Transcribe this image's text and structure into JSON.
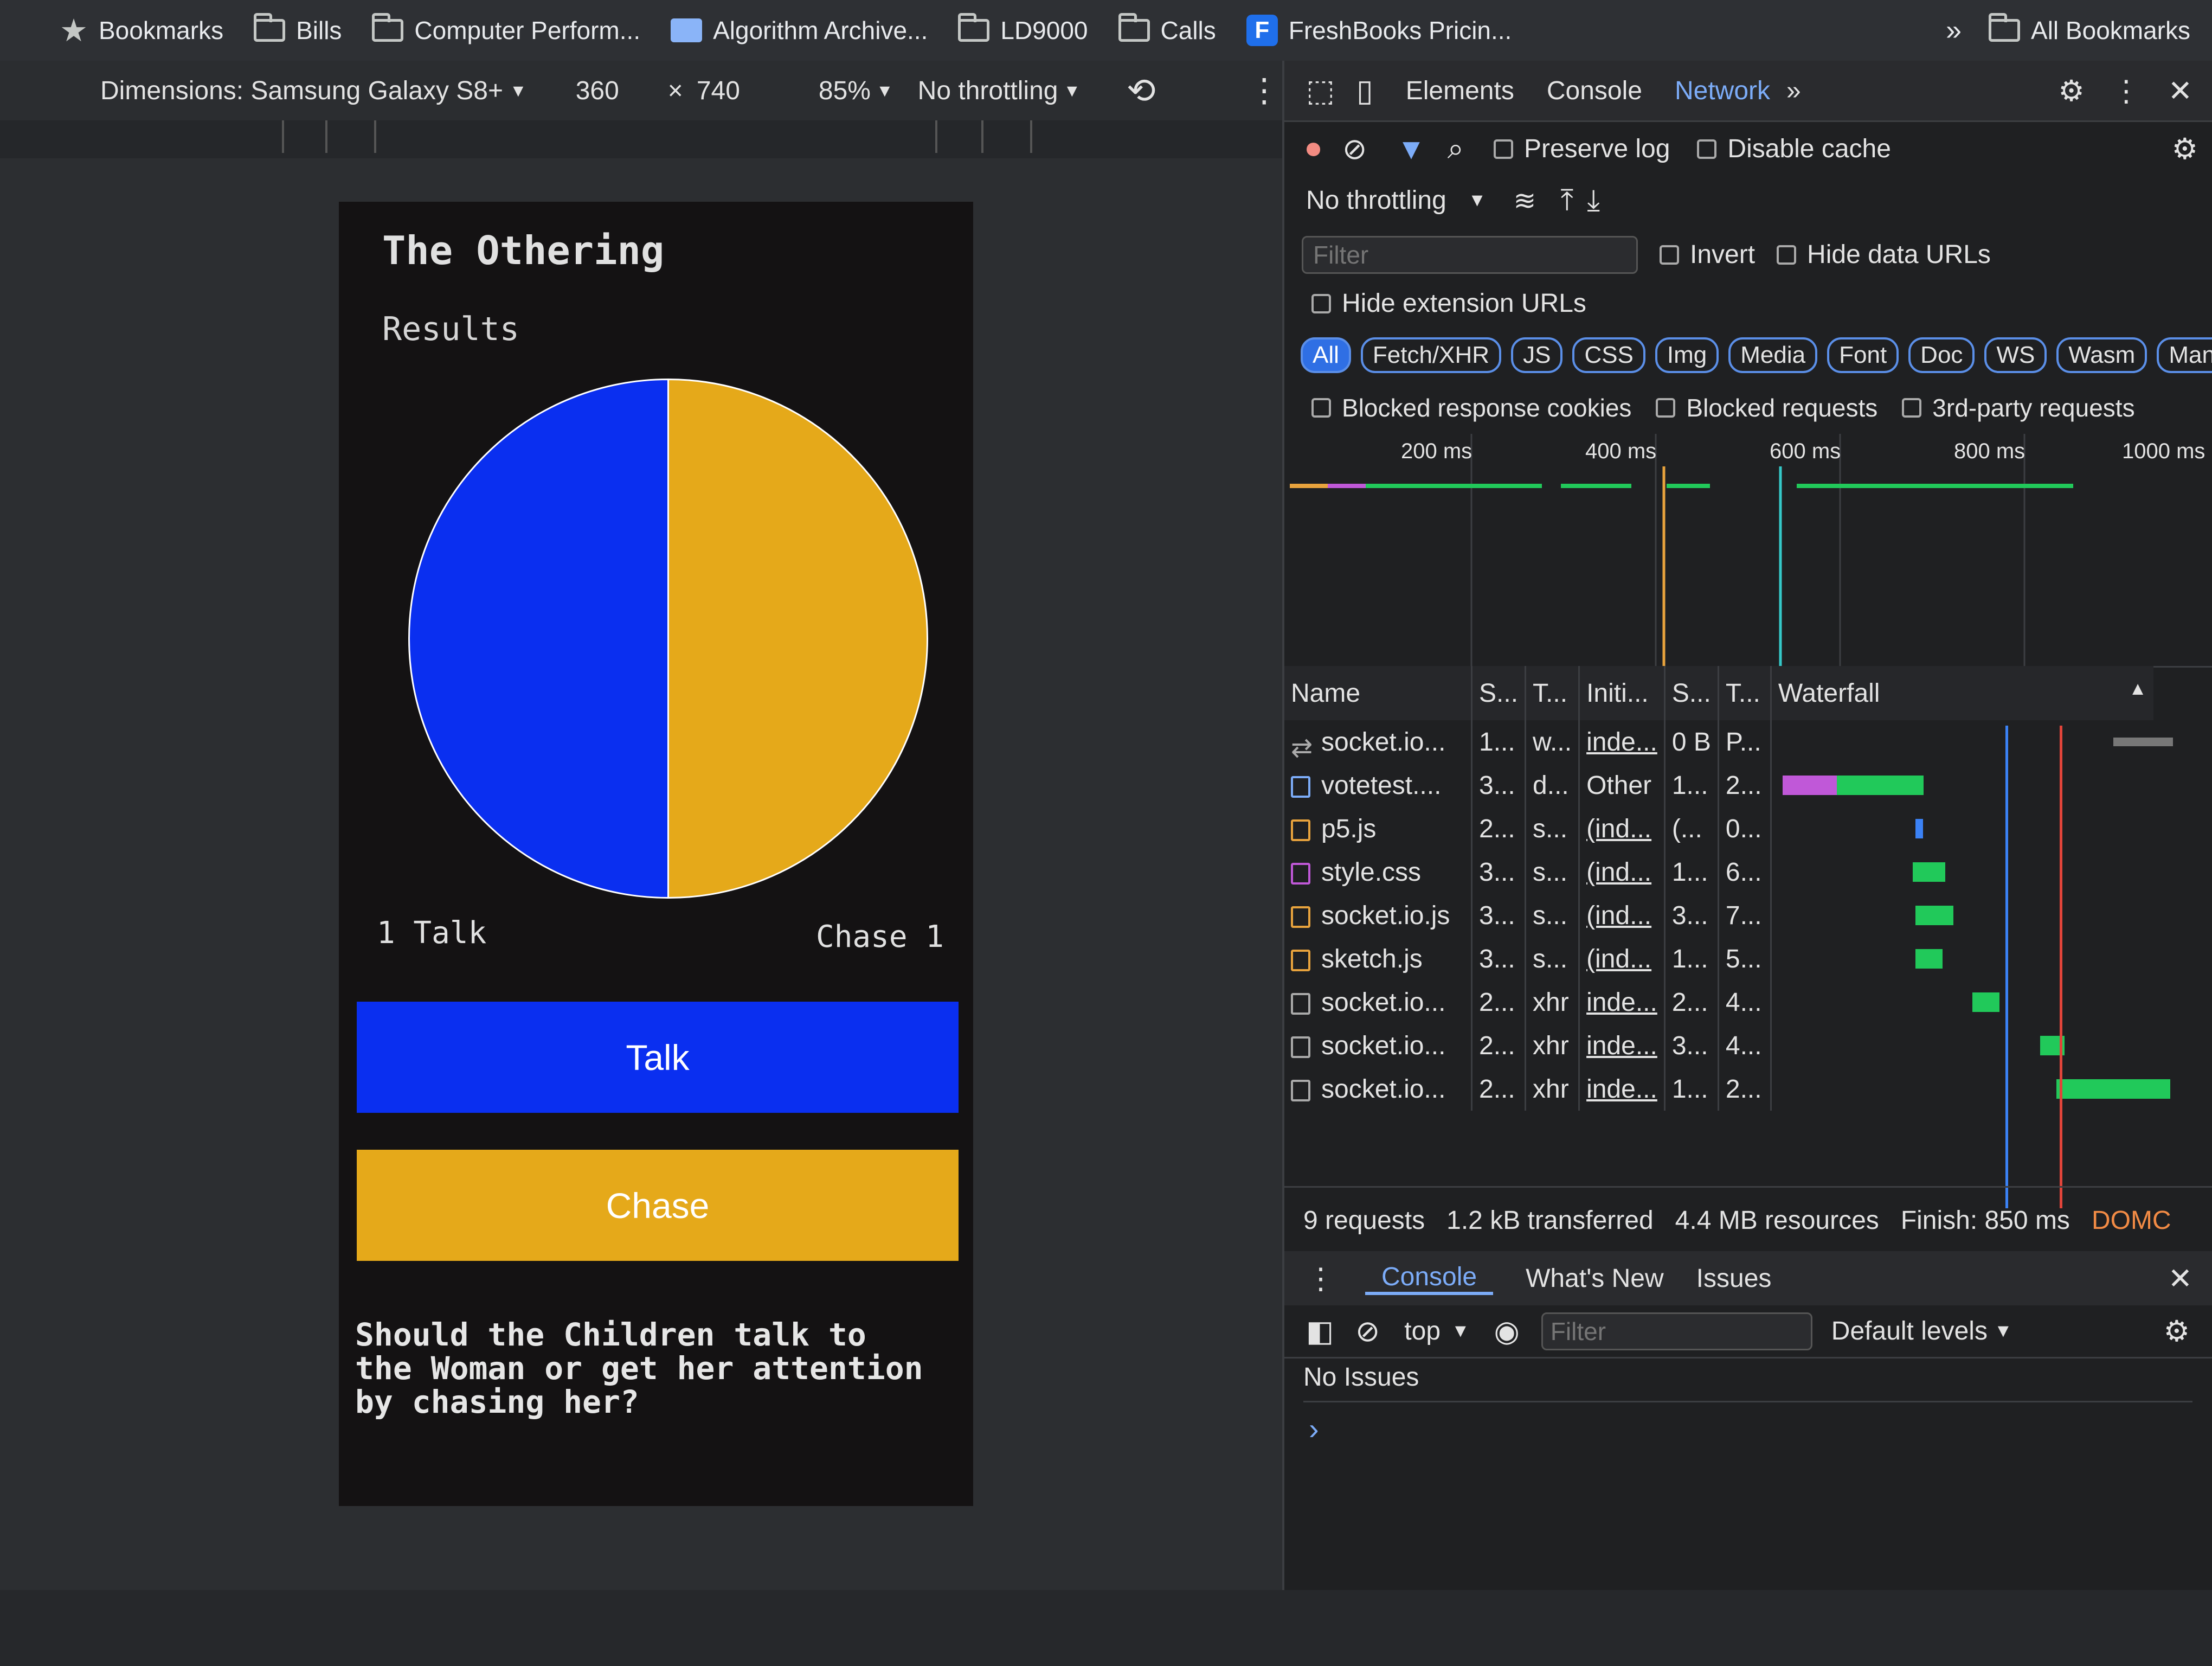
{
  "bookmarks_bar": {
    "items": [
      {
        "label": "Bookmarks",
        "icon": "star-icon"
      },
      {
        "label": "Bills",
        "icon": "folder-icon"
      },
      {
        "label": "Computer Perform...",
        "icon": "folder-icon"
      },
      {
        "label": "Algorithm Archive...",
        "icon": "doc-icon"
      },
      {
        "label": "LD9000",
        "icon": "folder-icon"
      },
      {
        "label": "Calls",
        "icon": "folder-icon"
      },
      {
        "label": "FreshBooks Pricin...",
        "icon": "freshbooks-icon"
      }
    ],
    "overflow": "»",
    "all_bookmarks": "All Bookmarks"
  },
  "device_toolbar": {
    "dimensions": "Dimensions: Samsung Galaxy S8+",
    "width": "360",
    "times": "×",
    "height": "740",
    "zoom": "85%",
    "throttling": "No throttling"
  },
  "app": {
    "title": "The Othering",
    "results_label": "Results",
    "talk_count_label": "1 Talk",
    "chase_count_label": "Chase 1",
    "talk_button": "Talk",
    "chase_button": "Chase",
    "question": "Should the Children talk to the Woman or get her attention by chasing her?",
    "colors": {
      "talk": "#0a2ff0",
      "chase": "#e5a91a"
    }
  },
  "chart_data": {
    "type": "pie",
    "categories": [
      "Talk",
      "Chase"
    ],
    "values": [
      1,
      1
    ],
    "colors": [
      "#0a2ff0",
      "#e5a91a"
    ],
    "title": "Results"
  },
  "devtools": {
    "tabs": [
      "Elements",
      "Console",
      "Network"
    ],
    "active_tab": "Network",
    "more_tabs": "»",
    "toolbar": {
      "preserve_log": "Preserve log",
      "disable_cache": "Disable cache",
      "throttling": "No throttling"
    },
    "filter": {
      "placeholder": "Filter",
      "invert": "Invert",
      "hide_data_urls": "Hide data URLs",
      "hide_extension_urls": "Hide extension URLs",
      "types": [
        "All",
        "Fetch/XHR",
        "JS",
        "CSS",
        "Img",
        "Media",
        "Font",
        "Doc",
        "WS",
        "Wasm",
        "Mani"
      ],
      "blocked_response_cookies": "Blocked response cookies",
      "blocked_requests": "Blocked requests",
      "third_party_requests": "3rd-party requests"
    },
    "timeline_labels": [
      "200 ms",
      "400 ms",
      "600 ms",
      "800 ms",
      "1000 ms"
    ],
    "table": {
      "columns": [
        "Name",
        "S...",
        "T...",
        "Initi...",
        "S...",
        "T...",
        "Waterfall"
      ],
      "rows": [
        {
          "name": "socket.io...",
          "status": "1...",
          "type": "w...",
          "initiator": "inde...",
          "size": "0 B",
          "time": "P..."
        },
        {
          "name": "votetest....",
          "status": "3...",
          "type": "d...",
          "initiator": "Other",
          "size": "1...",
          "time": "2..."
        },
        {
          "name": "p5.js",
          "status": "2...",
          "type": "s...",
          "initiator": "(ind...",
          "size": "(...",
          "time": "0..."
        },
        {
          "name": "style.css",
          "status": "3...",
          "type": "s...",
          "initiator": "(ind...",
          "size": "1...",
          "time": "6..."
        },
        {
          "name": "socket.io.js",
          "status": "3...",
          "type": "s...",
          "initiator": "(ind...",
          "size": "3...",
          "time": "7..."
        },
        {
          "name": "sketch.js",
          "status": "3...",
          "type": "s...",
          "initiator": "(ind...",
          "size": "1...",
          "time": "5..."
        },
        {
          "name": "socket.io...",
          "status": "2...",
          "type": "xhr",
          "initiator": "inde...",
          "size": "2...",
          "time": "4..."
        },
        {
          "name": "socket.io...",
          "status": "2...",
          "type": "xhr",
          "initiator": "inde...",
          "size": "3...",
          "time": "4..."
        },
        {
          "name": "socket.io...",
          "status": "2...",
          "type": "xhr",
          "initiator": "inde...",
          "size": "1...",
          "time": "2..."
        }
      ]
    },
    "status_bar": {
      "requests": "9 requests",
      "transferred": "1.2 kB transferred",
      "resources": "4.4 MB resources",
      "finish": "Finish: 850 ms",
      "domc": "DOMC"
    },
    "drawer": {
      "tabs": [
        "Console",
        "What's New",
        "Issues"
      ],
      "active_tab": "Console",
      "context": "top",
      "filter_placeholder": "Filter",
      "levels": "Default levels",
      "no_issues": "No Issues",
      "prompt": "›"
    }
  }
}
